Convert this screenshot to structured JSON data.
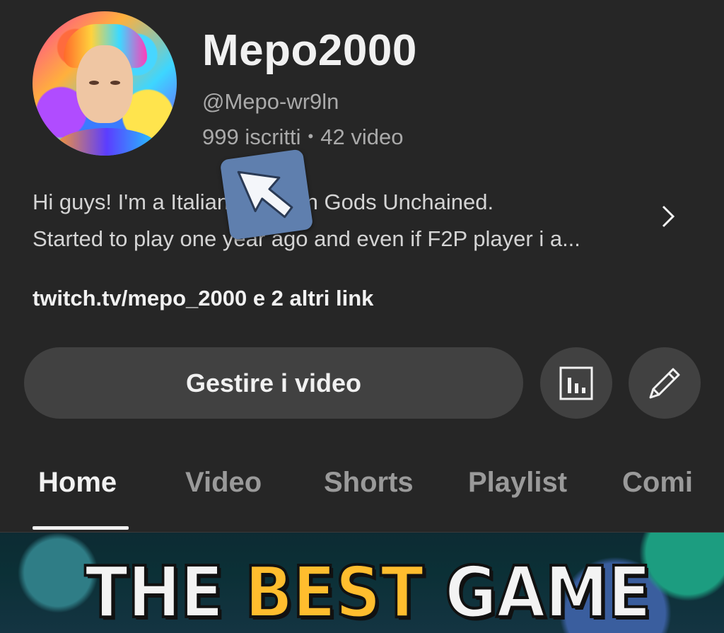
{
  "channel": {
    "name": "Mepo2000",
    "handle": "@Mepo-wr9ln",
    "subscribers": "999 iscritti",
    "separator": "•",
    "video_count": "42 video"
  },
  "description": {
    "line1": "Hi guys! I'm a Italian player in Gods Unchained.",
    "line2": "Started to play one year ago and even if F2P player i a..."
  },
  "links": {
    "text": "twitch.tv/mepo_2000 e 2 altri link"
  },
  "actions": {
    "manage_label": "Gestire i video",
    "analytics_icon": "analytics-icon",
    "edit_icon": "pencil-icon"
  },
  "tabs": [
    {
      "label": "Home",
      "active": true
    },
    {
      "label": "Video"
    },
    {
      "label": "Shorts"
    },
    {
      "label": "Playlist"
    },
    {
      "label": "Comi"
    }
  ],
  "banner": {
    "word1": "THE",
    "word2": "BEST",
    "word3": "GAME"
  },
  "colors": {
    "background": "#262626",
    "button_bg": "#414141",
    "banner_accent": "#ffbd2e"
  }
}
